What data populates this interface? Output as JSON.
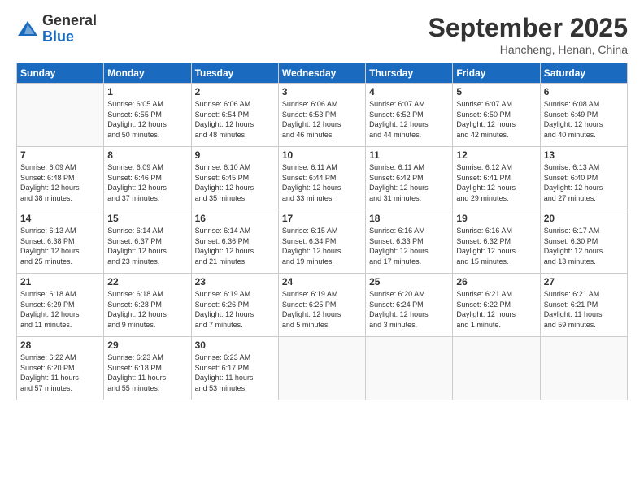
{
  "logo": {
    "general": "General",
    "blue": "Blue"
  },
  "header": {
    "month": "September 2025",
    "location": "Hancheng, Henan, China"
  },
  "days": [
    "Sunday",
    "Monday",
    "Tuesday",
    "Wednesday",
    "Thursday",
    "Friday",
    "Saturday"
  ],
  "weeks": [
    [
      {
        "num": "",
        "info": ""
      },
      {
        "num": "1",
        "info": "Sunrise: 6:05 AM\nSunset: 6:55 PM\nDaylight: 12 hours\nand 50 minutes."
      },
      {
        "num": "2",
        "info": "Sunrise: 6:06 AM\nSunset: 6:54 PM\nDaylight: 12 hours\nand 48 minutes."
      },
      {
        "num": "3",
        "info": "Sunrise: 6:06 AM\nSunset: 6:53 PM\nDaylight: 12 hours\nand 46 minutes."
      },
      {
        "num": "4",
        "info": "Sunrise: 6:07 AM\nSunset: 6:52 PM\nDaylight: 12 hours\nand 44 minutes."
      },
      {
        "num": "5",
        "info": "Sunrise: 6:07 AM\nSunset: 6:50 PM\nDaylight: 12 hours\nand 42 minutes."
      },
      {
        "num": "6",
        "info": "Sunrise: 6:08 AM\nSunset: 6:49 PM\nDaylight: 12 hours\nand 40 minutes."
      }
    ],
    [
      {
        "num": "7",
        "info": "Sunrise: 6:09 AM\nSunset: 6:48 PM\nDaylight: 12 hours\nand 38 minutes."
      },
      {
        "num": "8",
        "info": "Sunrise: 6:09 AM\nSunset: 6:46 PM\nDaylight: 12 hours\nand 37 minutes."
      },
      {
        "num": "9",
        "info": "Sunrise: 6:10 AM\nSunset: 6:45 PM\nDaylight: 12 hours\nand 35 minutes."
      },
      {
        "num": "10",
        "info": "Sunrise: 6:11 AM\nSunset: 6:44 PM\nDaylight: 12 hours\nand 33 minutes."
      },
      {
        "num": "11",
        "info": "Sunrise: 6:11 AM\nSunset: 6:42 PM\nDaylight: 12 hours\nand 31 minutes."
      },
      {
        "num": "12",
        "info": "Sunrise: 6:12 AM\nSunset: 6:41 PM\nDaylight: 12 hours\nand 29 minutes."
      },
      {
        "num": "13",
        "info": "Sunrise: 6:13 AM\nSunset: 6:40 PM\nDaylight: 12 hours\nand 27 minutes."
      }
    ],
    [
      {
        "num": "14",
        "info": "Sunrise: 6:13 AM\nSunset: 6:38 PM\nDaylight: 12 hours\nand 25 minutes."
      },
      {
        "num": "15",
        "info": "Sunrise: 6:14 AM\nSunset: 6:37 PM\nDaylight: 12 hours\nand 23 minutes."
      },
      {
        "num": "16",
        "info": "Sunrise: 6:14 AM\nSunset: 6:36 PM\nDaylight: 12 hours\nand 21 minutes."
      },
      {
        "num": "17",
        "info": "Sunrise: 6:15 AM\nSunset: 6:34 PM\nDaylight: 12 hours\nand 19 minutes."
      },
      {
        "num": "18",
        "info": "Sunrise: 6:16 AM\nSunset: 6:33 PM\nDaylight: 12 hours\nand 17 minutes."
      },
      {
        "num": "19",
        "info": "Sunrise: 6:16 AM\nSunset: 6:32 PM\nDaylight: 12 hours\nand 15 minutes."
      },
      {
        "num": "20",
        "info": "Sunrise: 6:17 AM\nSunset: 6:30 PM\nDaylight: 12 hours\nand 13 minutes."
      }
    ],
    [
      {
        "num": "21",
        "info": "Sunrise: 6:18 AM\nSunset: 6:29 PM\nDaylight: 12 hours\nand 11 minutes."
      },
      {
        "num": "22",
        "info": "Sunrise: 6:18 AM\nSunset: 6:28 PM\nDaylight: 12 hours\nand 9 minutes."
      },
      {
        "num": "23",
        "info": "Sunrise: 6:19 AM\nSunset: 6:26 PM\nDaylight: 12 hours\nand 7 minutes."
      },
      {
        "num": "24",
        "info": "Sunrise: 6:19 AM\nSunset: 6:25 PM\nDaylight: 12 hours\nand 5 minutes."
      },
      {
        "num": "25",
        "info": "Sunrise: 6:20 AM\nSunset: 6:24 PM\nDaylight: 12 hours\nand 3 minutes."
      },
      {
        "num": "26",
        "info": "Sunrise: 6:21 AM\nSunset: 6:22 PM\nDaylight: 12 hours\nand 1 minute."
      },
      {
        "num": "27",
        "info": "Sunrise: 6:21 AM\nSunset: 6:21 PM\nDaylight: 11 hours\nand 59 minutes."
      }
    ],
    [
      {
        "num": "28",
        "info": "Sunrise: 6:22 AM\nSunset: 6:20 PM\nDaylight: 11 hours\nand 57 minutes."
      },
      {
        "num": "29",
        "info": "Sunrise: 6:23 AM\nSunset: 6:18 PM\nDaylight: 11 hours\nand 55 minutes."
      },
      {
        "num": "30",
        "info": "Sunrise: 6:23 AM\nSunset: 6:17 PM\nDaylight: 11 hours\nand 53 minutes."
      },
      {
        "num": "",
        "info": ""
      },
      {
        "num": "",
        "info": ""
      },
      {
        "num": "",
        "info": ""
      },
      {
        "num": "",
        "info": ""
      }
    ]
  ]
}
